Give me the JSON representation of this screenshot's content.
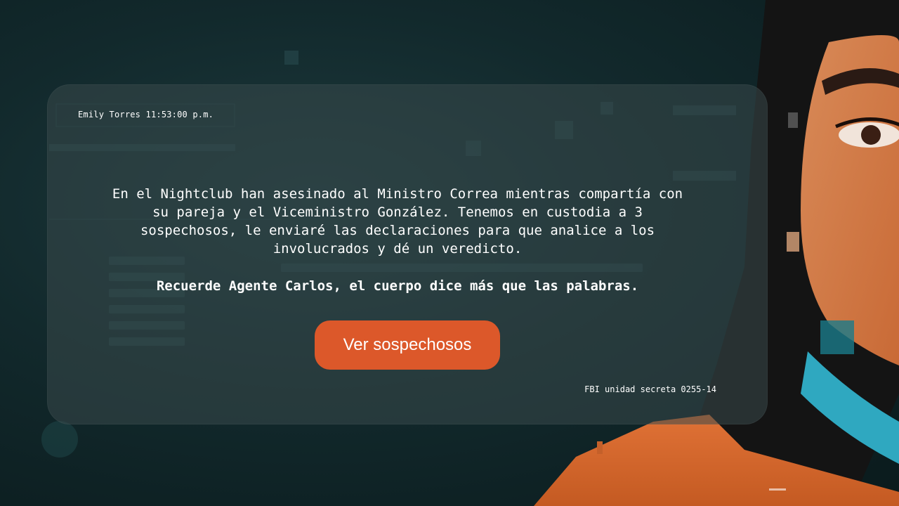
{
  "header": {
    "sender_name": "Emily Torres",
    "timestamp": "11:53:00 p.m."
  },
  "message": {
    "body": "En el Nightclub han asesinado al Ministro Correa mientras compartía con su pareja y el Viceministro González. Tenemos en custodia a 3 sospechosos, le enviaré las declaraciones para que analice a los involucrados y dé un veredicto.",
    "reminder": "Recuerde Agente Carlos, el cuerpo dice más que las palabras."
  },
  "actions": {
    "view_suspects_label": "Ver sospechosos"
  },
  "footer": {
    "unit_label": "FBI unidad secreta 0255-14"
  },
  "colors": {
    "accent": "#dc582a",
    "panel": "#38484a",
    "background": "#0b1c1f"
  }
}
